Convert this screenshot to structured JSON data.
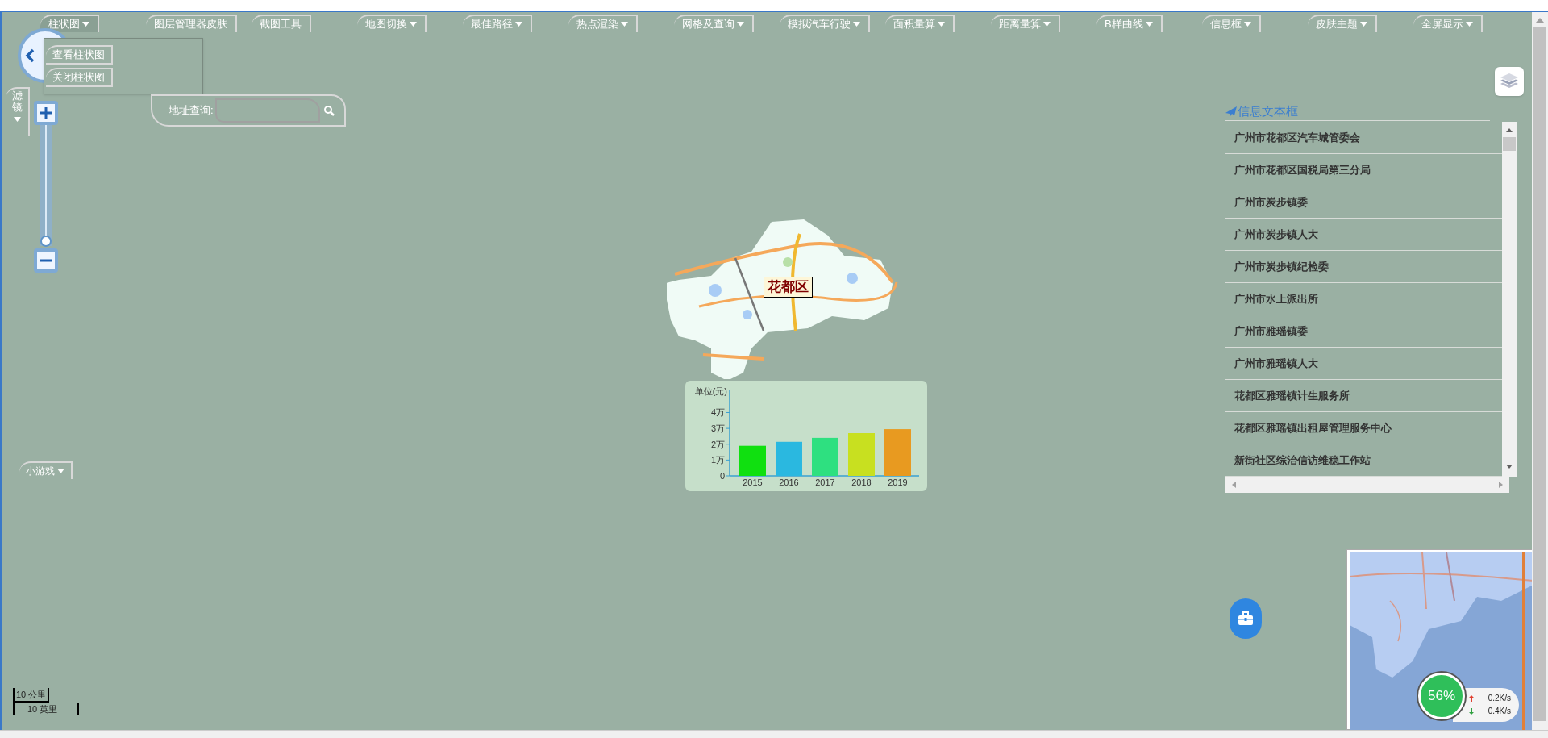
{
  "toolbar": [
    {
      "label": "柱状图",
      "dropdown": true,
      "expanded": true
    },
    {
      "label": "图层管理器皮肤",
      "dropdown": false,
      "expanded": false
    },
    {
      "label": "截图工具",
      "dropdown": false,
      "expanded": false
    },
    {
      "label": "地图切换",
      "dropdown": true,
      "expanded": false
    },
    {
      "label": "最佳路径",
      "dropdown": true,
      "expanded": false
    },
    {
      "label": "热点渲染",
      "dropdown": true,
      "expanded": false
    },
    {
      "label": "网格及查询",
      "dropdown": true,
      "expanded": false
    },
    {
      "label": "模拟汽车行驶",
      "dropdown": true,
      "expanded": false
    },
    {
      "label": "面积量算",
      "dropdown": true,
      "expanded": false
    },
    {
      "label": "距离量算",
      "dropdown": true,
      "expanded": false
    },
    {
      "label": "B样曲线",
      "dropdown": true,
      "expanded": false
    },
    {
      "label": "信息框",
      "dropdown": true,
      "expanded": false
    },
    {
      "label": "皮肤主题",
      "dropdown": true,
      "expanded": false
    },
    {
      "label": "全屏显示",
      "dropdown": true,
      "expanded": false
    }
  ],
  "dropdown_menu": {
    "items": [
      "查看柱状图",
      "关闭柱状图"
    ]
  },
  "filter_button": {
    "label": "滤镜"
  },
  "zoom": {
    "level": 0.02
  },
  "address_search": {
    "label": "地址查询:"
  },
  "game_button": {
    "label": "小游戏"
  },
  "map": {
    "label": "花都区"
  },
  "chart": {
    "chart_data": {
      "type": "bar",
      "ylabel": "单位(元)",
      "categories": [
        "2015",
        "2016",
        "2017",
        "2018",
        "2019"
      ],
      "series": [
        {
          "values": [
            1.9,
            2.15,
            2.4,
            2.7,
            2.95
          ]
        }
      ],
      "ylim": [
        0,
        5.4
      ],
      "yticks": [
        {
          "value": 0,
          "label": "0"
        },
        {
          "value": 1,
          "label": "1万"
        },
        {
          "value": 2,
          "label": "2万"
        },
        {
          "value": 3,
          "label": "3万"
        },
        {
          "value": 4,
          "label": "4万"
        }
      ]
    }
  },
  "info_panel": {
    "title": "信息文本框",
    "items": [
      "广州市花都区汽车城管委会",
      "广州市花都区国税局第三分局",
      "广州市炭步镇委",
      "广州市炭步镇人大",
      "广州市炭步镇纪检委",
      "广州市水上派出所",
      "广州市雅瑶镇委",
      "广州市雅瑶镇人大",
      "花都区雅瑶镇计生服务所",
      "花都区雅瑶镇出租屋管理服务中心",
      "新街社区综治信访维稳工作站"
    ]
  },
  "scale": {
    "metric": "10 公里",
    "imperial": "10 英里"
  },
  "network_widget": {
    "percent": "56%",
    "upload": "0.2K/s",
    "download": "0.4K/s"
  }
}
